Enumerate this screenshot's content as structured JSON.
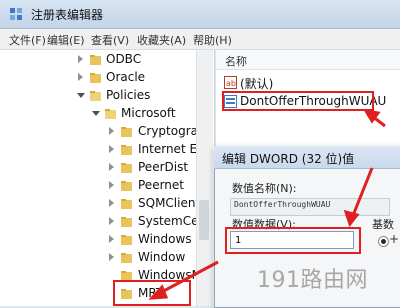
{
  "window": {
    "title": "注册表编辑器"
  },
  "menu": [
    "文件(F)",
    "编辑(E)",
    "查看(V)",
    "收藏夹(A)",
    "帮助(H)"
  ],
  "tree": {
    "items": [
      {
        "label": "ODBC"
      },
      {
        "label": "Oracle"
      },
      {
        "label": "Policies"
      },
      {
        "label": "Microsoft"
      },
      {
        "label": "Cryptograp"
      },
      {
        "label": "Internet Exp"
      },
      {
        "label": "PeerDist"
      },
      {
        "label": "Peernet"
      },
      {
        "label": "SQMClient"
      },
      {
        "label": "SystemCert"
      },
      {
        "label": "Windows"
      },
      {
        "label": "Window"
      },
      {
        "label": "WindowsM"
      },
      {
        "label": "MRT"
      }
    ]
  },
  "list": {
    "header_name": "名称",
    "rows": [
      {
        "label": "(默认)",
        "icon": "string-value-icon"
      },
      {
        "label": "DontOfferThroughWUAU",
        "icon": "dword-value-icon"
      }
    ]
  },
  "dialog": {
    "title": "编辑 DWORD (32 位)值",
    "value_name_label": "数值名称(N):",
    "value_name": "DontOfferThroughWUAU",
    "value_data_label": "数值数据(V):",
    "value_data": "1",
    "base_label": "基数",
    "base_option_partial": "+"
  },
  "watermark": "191路由网",
  "colors": {
    "highlight": "#e02020",
    "accent": "#3f78c4"
  }
}
